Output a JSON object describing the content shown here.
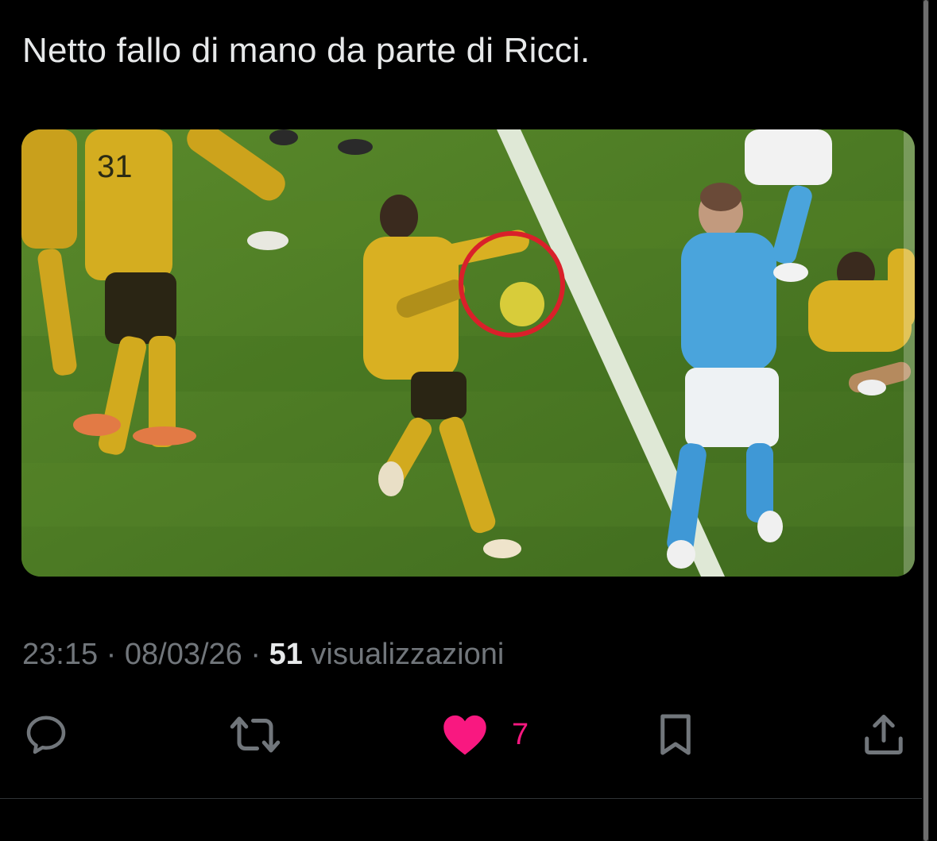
{
  "tweet": {
    "text": "Netto fallo di mano da parte di Ricci.",
    "time": "23:15",
    "separator": "·",
    "date": "08/03/26",
    "views_count": "51",
    "views_label": "visualizzazioni"
  },
  "media": {
    "highlight_color": "#d9202a",
    "pitch_color": "#4f7a26"
  },
  "actions": {
    "reply_icon": "reply-bubble-icon",
    "retweet_icon": "retweet-icon",
    "like_icon": "heart-filled-icon",
    "like_count": "7",
    "bookmark_icon": "bookmark-icon",
    "share_icon": "share-upload-icon"
  },
  "colors": {
    "background": "#000000",
    "text": "#e7e9ea",
    "muted": "#71767b",
    "like": "#f91880"
  }
}
